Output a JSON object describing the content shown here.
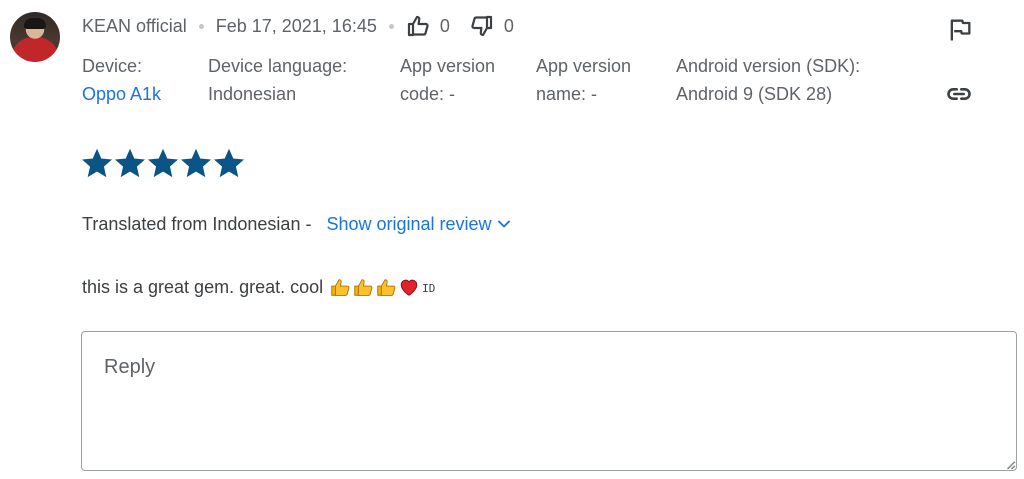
{
  "review": {
    "author": "KEAN official",
    "date": "Feb 17, 2021, 16:45",
    "thumbs_up_count": "0",
    "thumbs_down_count": "0",
    "rating": 5,
    "rating_max": 5,
    "translated_label": "Translated from Indonesian -",
    "show_original_label": "Show original review",
    "text": "this is a great gem. great. cool",
    "emoji_sequence": [
      "thumbs-up",
      "thumbs-up",
      "thumbs-up",
      "red-heart"
    ],
    "language_tag": "ID"
  },
  "details": {
    "device_label": "Device:",
    "device_value": "Oppo A1k",
    "device_language_label": "Device language:",
    "device_language_value": "Indonesian",
    "app_version_code_line1": "App version",
    "app_version_code_line2": "code: -",
    "app_version_name_line1": "App version",
    "app_version_name_line2": "name: -",
    "android_version_label": "Android version (SDK):",
    "android_version_value": "Android 9 (SDK 28)"
  },
  "reply": {
    "placeholder": "Reply"
  },
  "icons": {
    "flag": "flag-icon",
    "link": "link-icon",
    "thumbs_up": "thumbs-up-icon",
    "thumbs_down": "thumbs-down-icon",
    "star": "star-icon",
    "chevron": "chevron-down-icon"
  },
  "colors": {
    "star": "#0b5486",
    "link": "#1a73e8",
    "text": "#3c4043",
    "secondary": "#5f6368"
  }
}
